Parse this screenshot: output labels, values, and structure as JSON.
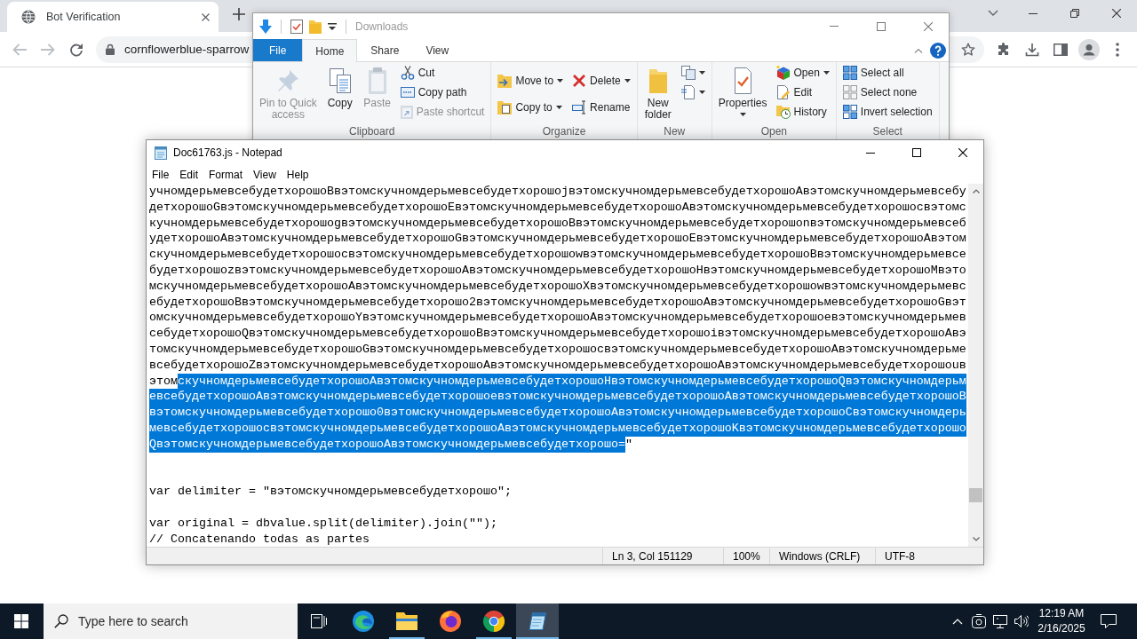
{
  "browser": {
    "tabs": [
      {
        "title": "Bot Verification",
        "selected": true
      }
    ],
    "back": {
      "disabled": true
    },
    "forward": {
      "disabled": true
    },
    "address": "cornflowerblue-sparrow"
  },
  "explorer": {
    "title": "Downloads",
    "ribbon_tabs": [
      {
        "label": "File",
        "kind": "menu",
        "selected": false
      },
      {
        "label": "Home",
        "kind": "tab",
        "selected": true
      },
      {
        "label": "Share",
        "kind": "tab",
        "selected": false
      },
      {
        "label": "View",
        "kind": "tab",
        "selected": false
      }
    ],
    "groups": [
      {
        "label": "Clipboard",
        "columns": [
          [
            {
              "kind": "large",
              "label": "Pin to Quick access",
              "disabled": true
            }
          ],
          [
            {
              "kind": "large",
              "label": "Copy",
              "disabled": false
            }
          ],
          [
            {
              "kind": "large",
              "label": "Paste",
              "disabled": true
            }
          ],
          [
            {
              "kind": "small",
              "label": "Cut",
              "disabled": false
            },
            {
              "kind": "small",
              "label": "Copy path",
              "disabled": false
            },
            {
              "kind": "small",
              "label": "Paste shortcut",
              "disabled": true
            }
          ]
        ]
      },
      {
        "label": "Organize",
        "columns": [
          [
            {
              "kind": "small",
              "label": "Move to",
              "dropdown": true,
              "disabled": false
            },
            {
              "kind": "small",
              "label": "Copy to",
              "dropdown": true,
              "disabled": false
            }
          ],
          [
            {
              "kind": "small",
              "label": "Delete",
              "dropdown": true,
              "disabled": false
            },
            {
              "kind": "small",
              "label": "Rename",
              "disabled": false
            }
          ]
        ]
      },
      {
        "label": "New",
        "columns": [
          [
            {
              "kind": "large",
              "label": "New folder",
              "disabled": false
            }
          ],
          [
            {
              "kind": "icon",
              "dropdown": true,
              "disabled": false
            },
            {
              "kind": "icon",
              "dropdown": true,
              "disabled": false
            }
          ]
        ]
      },
      {
        "label": "Open",
        "columns": [
          [
            {
              "kind": "large",
              "label": "Properties",
              "dropdown": true,
              "disabled": false
            }
          ],
          [
            {
              "kind": "small",
              "label": "Open",
              "dropdown": true,
              "disabled": false
            },
            {
              "kind": "small",
              "label": "Edit",
              "disabled": false
            },
            {
              "kind": "small",
              "label": "History",
              "disabled": false
            }
          ]
        ]
      },
      {
        "label": "Select",
        "columns": [
          [
            {
              "kind": "small",
              "label": "Select all",
              "disabled": false
            },
            {
              "kind": "small",
              "label": "Select none",
              "disabled": false
            },
            {
              "kind": "small",
              "label": "Invert selection",
              "disabled": false
            }
          ]
        ]
      }
    ]
  },
  "notepad": {
    "title": "Doc61763.js - Notepad",
    "menu": [
      "File",
      "Edit",
      "Format",
      "View",
      "Help"
    ],
    "lines": [
      {
        "kind": "text",
        "segments": [
          {
            "text": "учномдерьмевсебудетхорошоBвэтомскучномдерьмевсебудетхорошоjвэтомскучномдерьмевсебудетхорошоAвэтомскучномдерьмевсебу",
            "selected": false
          }
        ]
      },
      {
        "kind": "text",
        "segments": [
          {
            "text": "детхорошоGвэтомскучномдерьмевсебудетхорошоEвэтомскучномдерьмевсебудетхорошоAвэтомскучномдерьмевсебудетхорошоcвэтомс",
            "selected": false
          }
        ]
      },
      {
        "kind": "text",
        "segments": [
          {
            "text": "кучномдерьмевсебудетхорошоgвэтомскучномдерьмевсебудетхорошоBвэтомскучномдерьмевсебудетхорошоnвэтомскучномдерьмевсеб",
            "selected": false
          }
        ]
      },
      {
        "kind": "text",
        "segments": [
          {
            "text": "удетхорошоAвэтомскучномдерьмевсебудетхорошоGвэтомскучномдерьмевсебудетхорошоEвэтомскучномдерьмевсебудетхорошоAвэтом",
            "selected": false
          }
        ]
      },
      {
        "kind": "text",
        "segments": [
          {
            "text": "скучномдерьмевсебудетхорошоcвэтомскучномдерьмевсебудетхорошоwвэтомскучномдерьмевсебудетхорошоBвэтомскучномдерьмевсе",
            "selected": false
          }
        ]
      },
      {
        "kind": "text",
        "segments": [
          {
            "text": "будетхорошоzвэтомскучномдерьмевсебудетхорошоAвэтомскучномдерьмевсебудетхорошоHвэтомскучномдерьмевсебудетхорошоMвэто",
            "selected": false
          }
        ]
      },
      {
        "kind": "text",
        "segments": [
          {
            "text": "мскучномдерьмевсебудетхорошоAвэтомскучномдерьмевсебудетхорошоXвэтомскучномдерьмевсебудетхорошоwвэтомскучномдерьмевс",
            "selected": false
          }
        ]
      },
      {
        "kind": "text",
        "segments": [
          {
            "text": "ебудетхорошоBвэтомскучномдерьмевсебудетхорошо2вэтомскучномдерьмевсебудетхорошоAвэтомскучномдерьмевсебудетхорошоGвэт",
            "selected": false
          }
        ]
      },
      {
        "kind": "text",
        "segments": [
          {
            "text": "омскучномдерьмевсебудетхорошоYвэтомскучномдерьмевсебудетхорошоAвэтомскучномдерьмевсебудетхорошоeвэтомскучномдерьмев",
            "selected": false
          }
        ]
      },
      {
        "kind": "text",
        "segments": [
          {
            "text": "себудетхорошоQвэтомскучномдерьмевсебудетхорошоBвэтомскучномдерьмевсебудетхорошоiвэтомскучномдерьмевсебудетхорошоAвэ",
            "selected": false
          }
        ]
      },
      {
        "kind": "text",
        "segments": [
          {
            "text": "томскучномдерьмевсебудетхорошоGвэтомскучномдерьмевсебудетхорошоcвэтомскучномдерьмевсебудетхорошоAвэтомскучномдерьме",
            "selected": false
          }
        ]
      },
      {
        "kind": "text",
        "segments": [
          {
            "text": "всебудетхорошоZвэтомскучномдерьмевсебудетхорошоAвэтомскучномдерьмевсебудетхорошоAвэтомскучномдерьмевсебудетхорошоuв",
            "selected": false
          }
        ]
      },
      {
        "kind": "text",
        "segments": [
          {
            "text": "этом",
            "selected": false
          },
          {
            "text": "скучномдерьмевсебудетхорошоAвэтомскучномдерьмевсебудетхорошоHвэтомскучномдерьмевсебудетхорошоQвэтомскучномдерьм",
            "selected": true
          }
        ]
      },
      {
        "kind": "text",
        "segments": [
          {
            "text": "евсебудетхорошоAвэтомскучномдерьмевсебудетхорошоeвэтомскучномдерьмевсебудетхорошоAвэтомскучномдерьмевсебудетхорошоB",
            "selected": true
          }
        ]
      },
      {
        "kind": "text",
        "segments": [
          {
            "text": "вэтомскучномдерьмевсебудетхорошо0вэтомскучномдерьмевсебудетхорошоAвэтомскучномдерьмевсебудетхорошоCвэтомскучномдерь",
            "selected": true
          }
        ]
      },
      {
        "kind": "text",
        "segments": [
          {
            "text": "мевсебудетхорошоcвэтомскучномдерьмевсебудетхорошоAвэтомскучномдерьмевсебудетхорошоKвэтомскучномдерьмевсебудетхорошо",
            "selected": true
          }
        ]
      },
      {
        "kind": "text",
        "segments": [
          {
            "text": "QвэтомскучномдерьмевсебудетхорошоAвэтомскучномдерьмевсебудетхорошо=",
            "selected": true
          },
          {
            "text": "\"",
            "selected": false
          }
        ]
      },
      {
        "kind": "blank"
      },
      {
        "kind": "blank"
      },
      {
        "kind": "text",
        "segments": [
          {
            "text": "var delimiter = \"вэтомскучномдерьмевсебудетхорошо\";",
            "selected": false
          }
        ]
      },
      {
        "kind": "blank"
      },
      {
        "kind": "text",
        "segments": [
          {
            "text": "var original = dbvalue.split(delimiter).join(\"\");",
            "selected": false
          }
        ]
      },
      {
        "kind": "text",
        "segments": [
          {
            "text": "// Concatenando todas as partes",
            "selected": false
          }
        ]
      }
    ],
    "status": [
      "Ln 3, Col 151129",
      "100%",
      "Windows (CRLF)",
      "UTF-8"
    ]
  },
  "taskbar": {
    "search": {
      "placeholder": "Type here to search"
    },
    "apps": [
      {
        "running": false,
        "active": false
      },
      {
        "running": true,
        "active": false
      },
      {
        "running": false,
        "active": false
      },
      {
        "running": true,
        "active": false
      },
      {
        "running": true,
        "active": true
      }
    ],
    "clock": {
      "time": "12:19 AM",
      "date": "2/16/2025"
    }
  }
}
